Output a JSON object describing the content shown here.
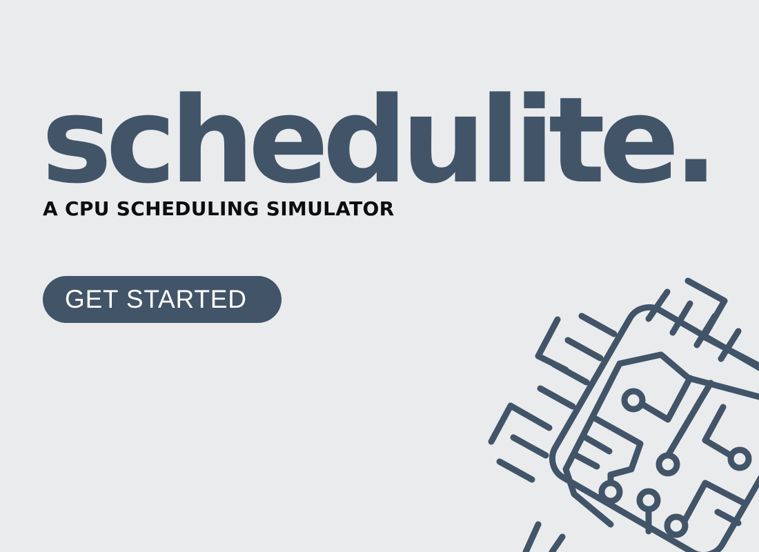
{
  "brand": {
    "title": "schedulite.",
    "tagline": "A CPU SCHEDULING SIMULATOR"
  },
  "actions": {
    "get_started_label": "GET STARTED"
  },
  "colors": {
    "background": "#e9ebed",
    "primary": "#425468",
    "tagline_text": "#0d0d0d",
    "button_text": "#ffffff"
  },
  "decoration": {
    "icon": "cpu-chip-icon"
  }
}
